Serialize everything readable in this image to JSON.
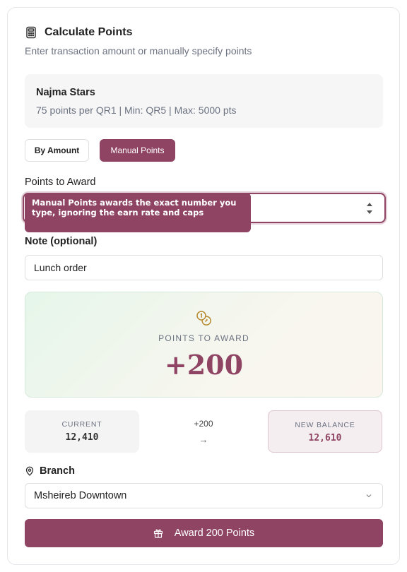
{
  "header": {
    "title": "Calculate Points",
    "subtitle": "Enter transaction amount or manually specify points",
    "icon": "calculator-icon"
  },
  "program": {
    "name": "Najma Stars",
    "rules": "75 points per QR1 | Min: QR5 | Max: 5000 pts"
  },
  "mode_toggle": {
    "by_amount_label": "By Amount",
    "manual_label": "Manual Points",
    "selected": "Manual Points"
  },
  "points_field": {
    "label": "Points to Award",
    "value": "",
    "tooltip": "Manual Points awards the exact number you type, ignoring the earn rate and caps"
  },
  "note_field": {
    "label": "Note (optional)",
    "value": "Lunch order"
  },
  "award_summary": {
    "caption": "POINTS TO AWARD",
    "value": "+200",
    "icon": "coins-icon"
  },
  "balances": {
    "current_label": "CURRENT",
    "current_value": "12,410",
    "delta": "+200",
    "arrow": "→",
    "new_label": "NEW BALANCE",
    "new_value": "12,610"
  },
  "branch": {
    "label": "Branch",
    "selected": "Msheireb Downtown",
    "icon": "map-pin-icon"
  },
  "submit": {
    "label": "Award 200 Points",
    "icon": "gift-icon"
  },
  "colors": {
    "accent": "#8e4462",
    "panel_bg": "#f6f6f7",
    "summary_gradient_start": "#e6f6ea"
  }
}
